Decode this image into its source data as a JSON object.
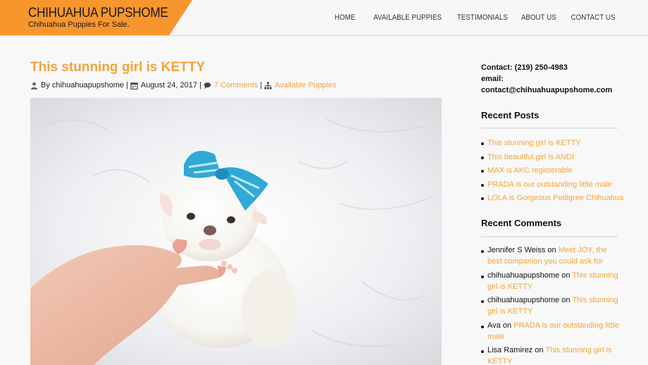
{
  "header": {
    "site_title": "CHIHUAHUA PUPSHOME",
    "tagline": "Chihuahua Puppies For Sale.",
    "brand_color": "#f7962c",
    "nav": [
      "HOME",
      "AVAILABLE PUPPIES",
      "TESTIMONIALS",
      "ABOUT US",
      "CONTACT US"
    ]
  },
  "post": {
    "title": "This stunning girl is KETTY",
    "author_prefix": "By",
    "author": "chihuahuapupshome",
    "date": "August 24, 2017",
    "comments": "7 Comments",
    "category": "Available Puppies",
    "separator": "|",
    "accent_color": "#f0a43a",
    "meta_icons": [
      "user-icon",
      "calendar-icon",
      "comments-icon",
      "sitemap-icon"
    ]
  },
  "sidebar": {
    "contact": {
      "phone": "Contact: (219) 250-4983",
      "email_label": "email:",
      "email": "contact@chihuahuapupshome.com"
    },
    "recent_posts": {
      "title": "Recent Posts",
      "items": [
        "This stunning girl is KETTY",
        "This beautiful girl is ANDI",
        "MAX is AKC registerable",
        "PRADA is our outstanding little male",
        "LOLA is Gorgeous Pedigree Chihuahua"
      ]
    },
    "recent_comments": {
      "title": "Recent Comments",
      "on_word": "on",
      "items": [
        {
          "author": "Jennifer S Weiss",
          "post": "Meet JOY, the best companion you could ask for"
        },
        {
          "author": "chihuahuapupshome",
          "post": "This stunning girl is KETTY"
        },
        {
          "author": "chihuahuapupshome",
          "post": "This stunning girl is KETTY"
        },
        {
          "author": "Ava",
          "post": "PRADA is our outstanding little male"
        },
        {
          "author": "Lisa Ramirez",
          "post": "This stunning girl is KETTY"
        }
      ]
    }
  }
}
